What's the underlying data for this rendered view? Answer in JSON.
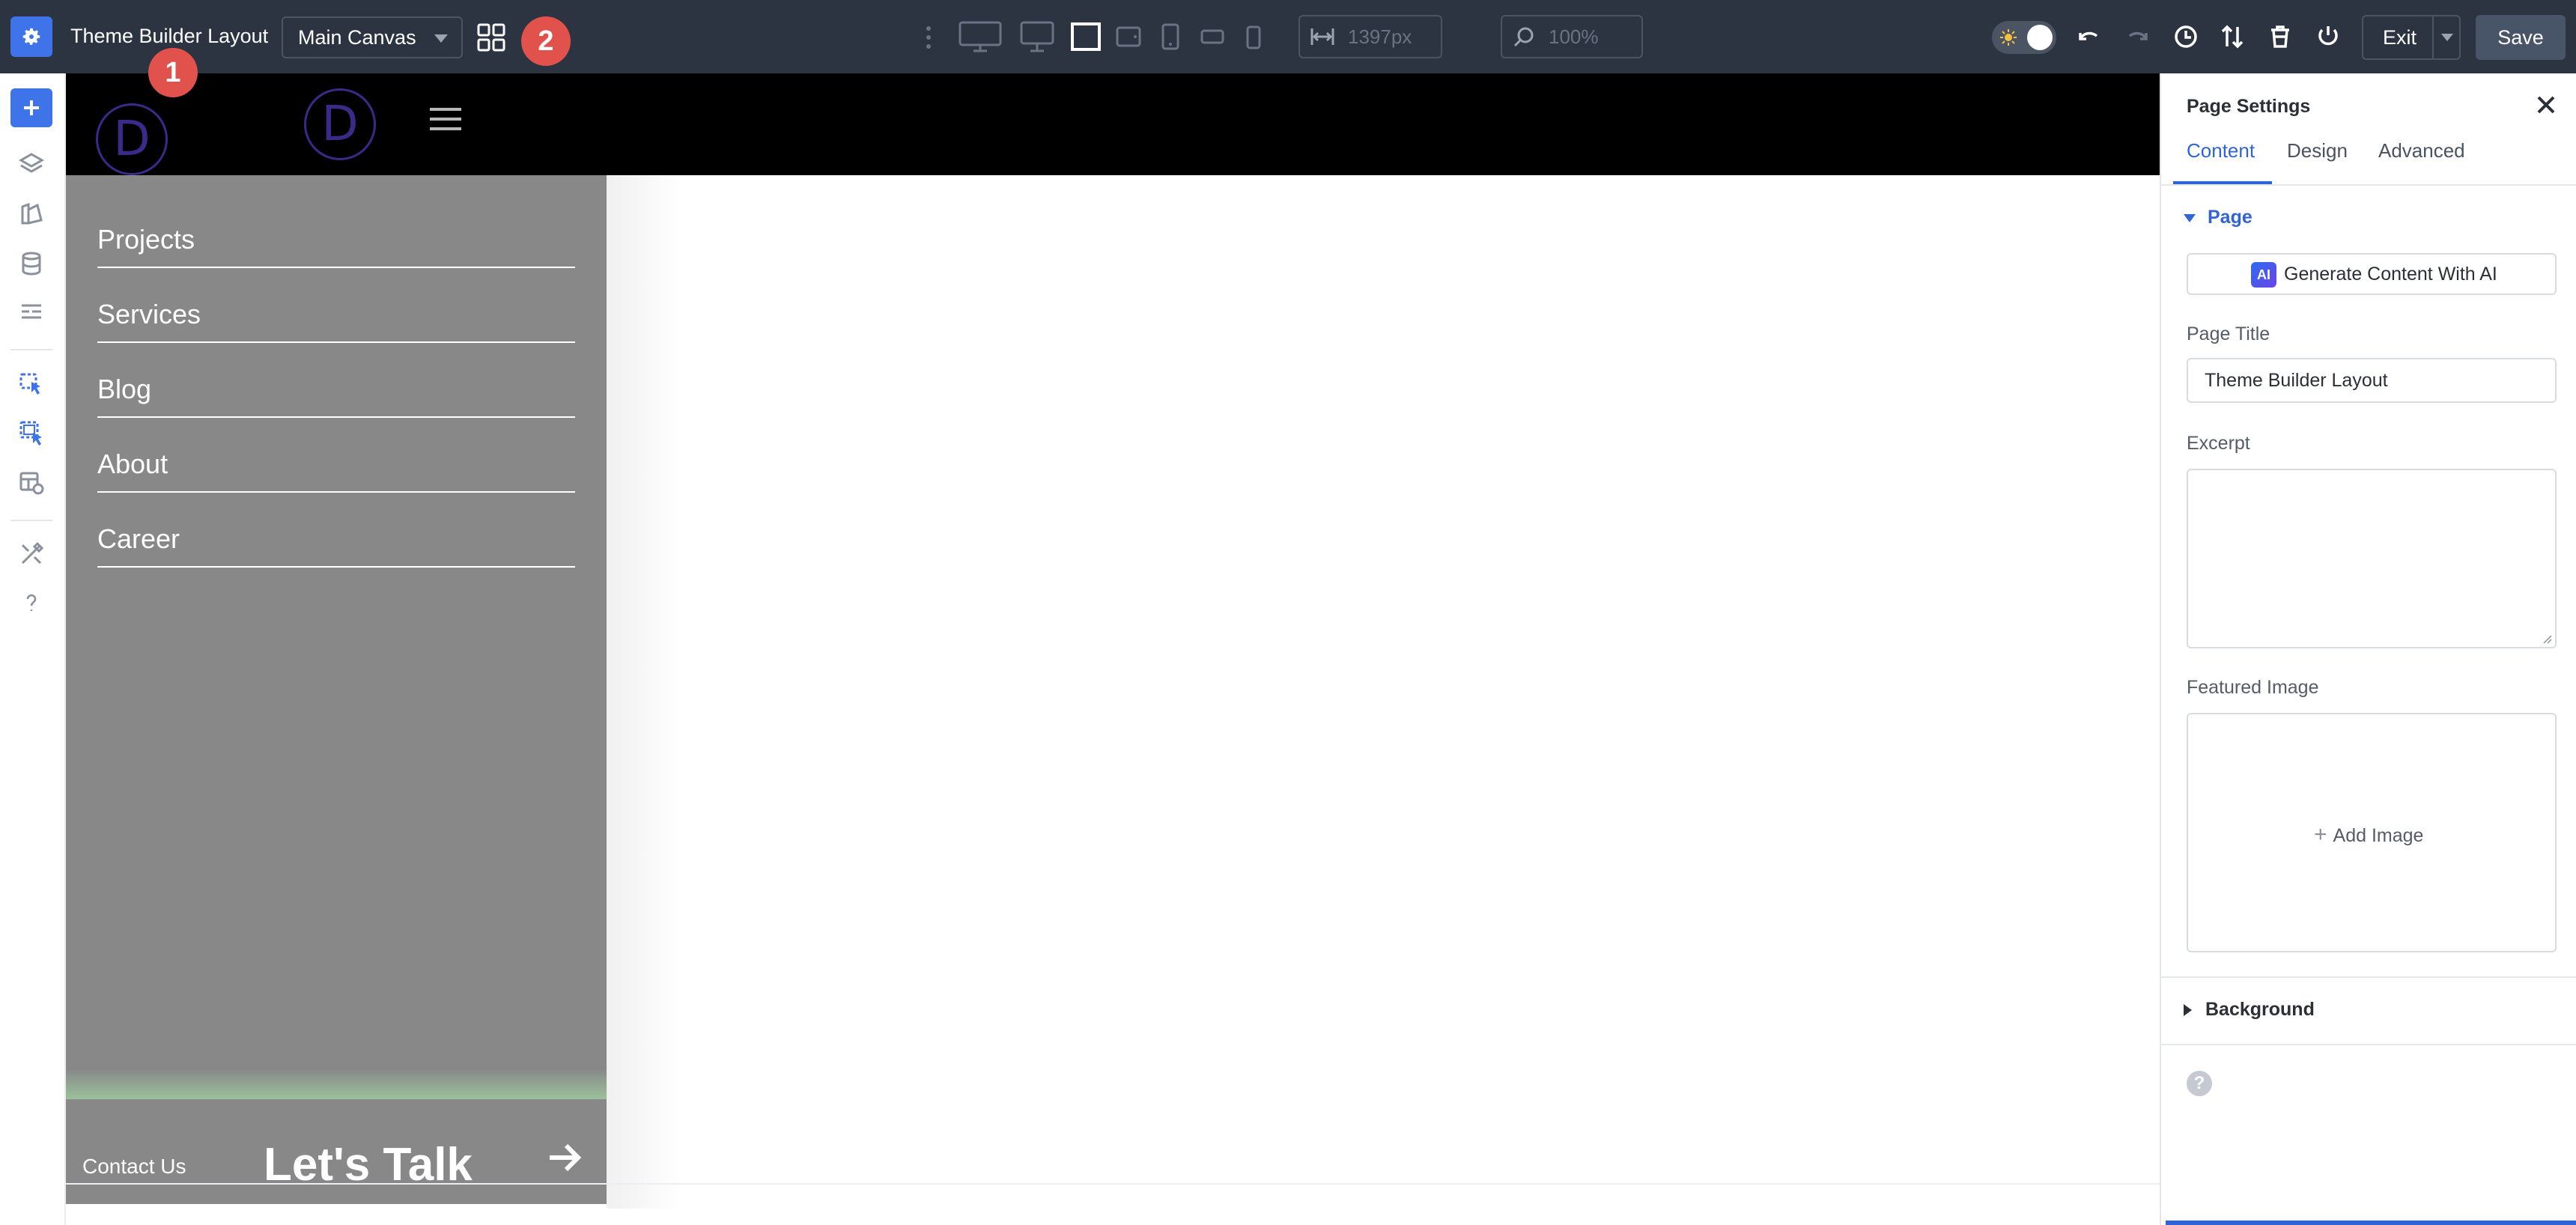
{
  "topbar": {
    "title": "Theme Builder Layout",
    "canvas_select": "Main Canvas",
    "badge_1": "1",
    "badge_2": "2",
    "width_value": "1397px",
    "zoom_value": "100%",
    "exit_label": "Exit",
    "save_label": "Save"
  },
  "canvas": {
    "logo_letter": "D",
    "menu": [
      "Projects",
      "Services",
      "Blog",
      "About",
      "Career"
    ],
    "contact_label": "Contact Us",
    "lets_talk": "Let's Talk"
  },
  "panel": {
    "title": "Page Settings",
    "tabs": [
      "Content",
      "Design",
      "Advanced"
    ],
    "section_page": "Page",
    "ai_chip": "AI",
    "ai_button": "Generate Content With AI",
    "page_title_label": "Page Title",
    "page_title_value": "Theme Builder Layout",
    "excerpt_label": "Excerpt",
    "featured_image_label": "Featured Image",
    "add_image": "Add Image",
    "section_background": "Background",
    "help": "?"
  },
  "colors": {
    "accent": "#3e73ea",
    "topbar_bg": "#2c3441",
    "badge": "#e0524b",
    "menu_bg": "#888888",
    "tab_active": "#2f63d6"
  }
}
